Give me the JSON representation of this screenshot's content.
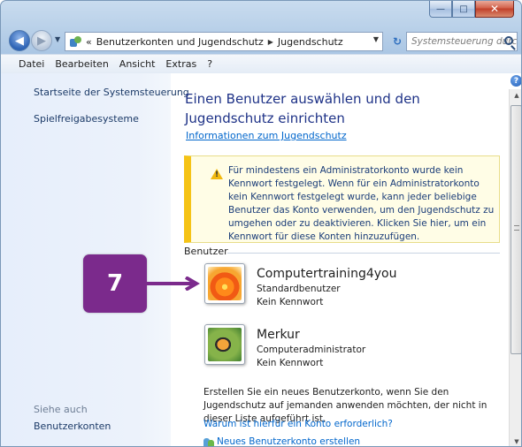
{
  "window": {
    "caption_minimize": "—",
    "caption_maximize": "□",
    "caption_close": "✕"
  },
  "address": {
    "overflow": "«",
    "breadcrumbs": [
      "Benutzerkonten und Jugendschutz",
      "Jugendschutz"
    ],
    "search_placeholder": "Systemsteuerung durc..."
  },
  "menu": [
    "Datei",
    "Bearbeiten",
    "Ansicht",
    "Extras",
    "?"
  ],
  "sidebar": {
    "links": [
      "Startseite der Systemsteuerung",
      "Spielfreigabesysteme"
    ],
    "see_also_label": "Siehe auch",
    "see_also_links": [
      "Benutzerkonten"
    ]
  },
  "main": {
    "heading": "Einen Benutzer auswählen und den Jugendschutz einrichten",
    "info_link": "Informationen zum Jugendschutz",
    "warning_text": "Für mindestens ein Administratorkonto wurde kein Kennwort festgelegt. Wenn für ein Administratorkonto kein Kennwort festgelegt wurde, kann jeder beliebige Benutzer das Konto verwenden, um den Jugendschutz zu umgehen oder zu deaktivieren. Klicken Sie hier, um ein Kennwort für diese Konten hinzuzufügen.",
    "group_label": "Benutzer",
    "users": [
      {
        "name": "Computertraining4you",
        "type": "Standardbenutzer",
        "password": "Kein Kennwort",
        "picture": "flower"
      },
      {
        "name": "Merkur",
        "type": "Computeradministrator",
        "password": "Kein Kennwort",
        "picture": "butterfly"
      }
    ],
    "footer_text": "Erstellen Sie ein neues Benutzerkonto, wenn Sie den Jugendschutz auf jemanden anwenden möchten, der nicht in dieser Liste aufgeführt ist.",
    "why_link": "Warum ist hierfür ein Konto erforderlich?",
    "new_account_link": "Neues Benutzerkonto erstellen"
  },
  "callout": {
    "number": "7",
    "color": "#7b2a8c"
  }
}
